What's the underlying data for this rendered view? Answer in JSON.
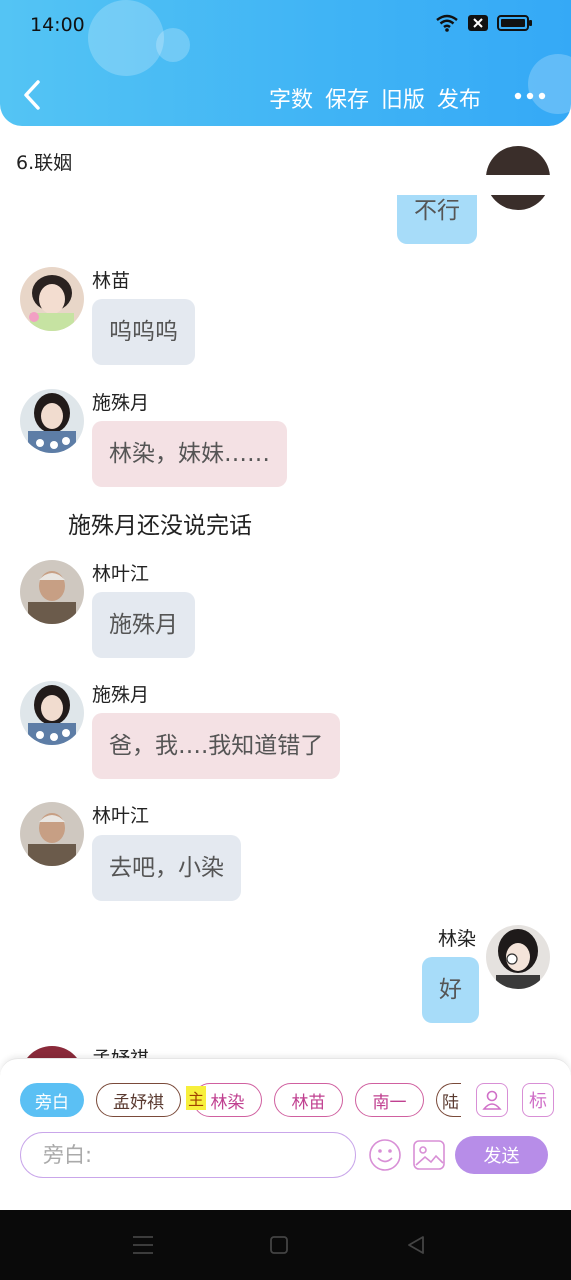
{
  "status": {
    "time": "14:00"
  },
  "toolbar": {
    "word_count": "字数",
    "save": "保存",
    "old_version": "旧版",
    "publish": "发布"
  },
  "chapter_title": "6.联姻",
  "messages": [
    {
      "side": "right",
      "text": "不行"
    },
    {
      "side": "left",
      "name": "林苗",
      "text": "呜呜呜"
    },
    {
      "side": "left",
      "name": "施殊月",
      "text": "林染，妹妹……"
    },
    {
      "side": "narration",
      "text": "施殊月还没说完话"
    },
    {
      "side": "left",
      "name": "林叶江",
      "text": "施殊月"
    },
    {
      "side": "left",
      "name": "施殊月",
      "text": "爸，我….我知道错了"
    },
    {
      "side": "left",
      "name": "林叶江",
      "text": "去吧，小染"
    },
    {
      "side": "right",
      "name": "林染",
      "text": "好"
    },
    {
      "side": "left",
      "name": "孟妤祺"
    }
  ],
  "characters": {
    "narrator": "旁白",
    "c1": "孟妤祺",
    "main_tag": "主",
    "c2": "林染",
    "c3": "林苗",
    "c4": "南一",
    "c5": "陆"
  },
  "tag_button": "标",
  "input": {
    "placeholder": "旁白:"
  },
  "send_label": "发送"
}
